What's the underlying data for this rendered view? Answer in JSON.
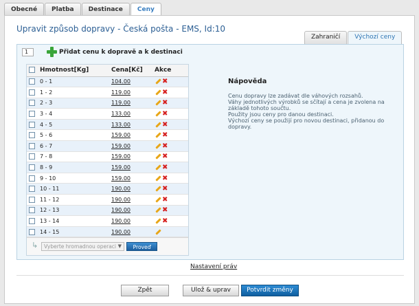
{
  "top_tabs": [
    {
      "label": "Obecné"
    },
    {
      "label": "Platba"
    },
    {
      "label": "Destinace"
    },
    {
      "label": "Ceny"
    }
  ],
  "page_title": "Upravit způsob dopravy - Česká pošta - EMS, Id:10",
  "sub_tabs": [
    {
      "label": "Zahraničí"
    },
    {
      "label": "Výchozí ceny"
    }
  ],
  "add_price": {
    "quantity": "1",
    "label": "Přidat cenu k dopravě a k destinaci"
  },
  "table": {
    "headers": {
      "weight": "Hmotnost[Kg]",
      "price": "Cena[Kč]",
      "action": "Akce"
    },
    "rows": [
      {
        "weight": "0 - 1",
        "price": "104.00"
      },
      {
        "weight": "1 - 2",
        "price": "119.00"
      },
      {
        "weight": "2 - 3",
        "price": "119.00"
      },
      {
        "weight": "3 - 4",
        "price": "133.00"
      },
      {
        "weight": "4 - 5",
        "price": "133.00"
      },
      {
        "weight": "5 - 6",
        "price": "159.00"
      },
      {
        "weight": "6 - 7",
        "price": "159.00"
      },
      {
        "weight": "7 - 8",
        "price": "159.00"
      },
      {
        "weight": "8 - 9",
        "price": "159.00"
      },
      {
        "weight": "9 - 10",
        "price": "159.00"
      },
      {
        "weight": "10 - 11",
        "price": "190.00"
      },
      {
        "weight": "11 - 12",
        "price": "190.00"
      },
      {
        "weight": "12 - 13",
        "price": "190.00"
      },
      {
        "weight": "13 - 14",
        "price": "190.00"
      },
      {
        "weight": "14 - 15",
        "price": "190.00"
      }
    ]
  },
  "bulk": {
    "select_placeholder": "Vyberte hromadnou operaci",
    "go_label": "Proveď"
  },
  "help": {
    "title": "Nápověda",
    "lines": [
      "Cenu dopravy lze zadávat dle váhových rozsahů.",
      "Váhy jednotlivých výrobků se sčítají a cena je zvolena na",
      "základě tohoto součtu.",
      "Použity jsou ceny pro danou destinaci.",
      "Výchozí ceny se použijí pro novou destinaci, přidanou do",
      "dopravy."
    ]
  },
  "settings_link": "Nastavení práv",
  "buttons": {
    "back": "Zpět",
    "save_edit": "Ulož & uprav",
    "confirm": "Potvrdit změny"
  },
  "colors": {
    "accent": "#2c74b3",
    "panel_bg": "#eef6fb",
    "delete": "#d62020",
    "add": "#3aa53a"
  }
}
